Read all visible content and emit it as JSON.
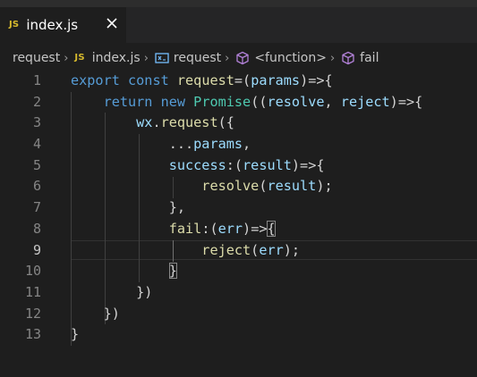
{
  "tab": {
    "icon_text": "JS",
    "label": "index.js"
  },
  "breadcrumb": [
    {
      "label": "request"
    },
    {
      "icon_text": "JS",
      "label": "index.js"
    },
    {
      "label": "request"
    },
    {
      "label": "<function>"
    },
    {
      "label": "fail"
    }
  ],
  "editor": {
    "line_numbers": [
      "1",
      "2",
      "3",
      "4",
      "5",
      "6",
      "7",
      "8",
      "9",
      "10",
      "11",
      "12",
      "13"
    ],
    "active_line": 9,
    "lines": [
      [
        {
          "t": "export ",
          "c": "k"
        },
        {
          "t": "const ",
          "c": "k"
        },
        {
          "t": "request",
          "c": "f"
        },
        {
          "t": "=(",
          "c": "p"
        },
        {
          "t": "params",
          "c": "v"
        },
        {
          "t": ")=>{",
          "c": "p"
        }
      ],
      [
        {
          "t": "    return ",
          "c": "k"
        },
        {
          "t": "new ",
          "c": "k"
        },
        {
          "t": "Promise",
          "c": "c"
        },
        {
          "t": "((",
          "c": "p"
        },
        {
          "t": "resolve",
          "c": "v"
        },
        {
          "t": ", ",
          "c": "p"
        },
        {
          "t": "reject",
          "c": "v"
        },
        {
          "t": ")=>{",
          "c": "p"
        }
      ],
      [
        {
          "t": "        wx",
          "c": "v"
        },
        {
          "t": ".",
          "c": "p"
        },
        {
          "t": "request",
          "c": "f"
        },
        {
          "t": "({",
          "c": "p"
        }
      ],
      [
        {
          "t": "            ...",
          "c": "p"
        },
        {
          "t": "params",
          "c": "v"
        },
        {
          "t": ",",
          "c": "p"
        }
      ],
      [
        {
          "t": "            success",
          "c": "v"
        },
        {
          "t": ":(",
          "c": "p"
        },
        {
          "t": "result",
          "c": "v"
        },
        {
          "t": ")=>{",
          "c": "p"
        }
      ],
      [
        {
          "t": "                resolve",
          "c": "f"
        },
        {
          "t": "(",
          "c": "p"
        },
        {
          "t": "result",
          "c": "v"
        },
        {
          "t": ");",
          "c": "p"
        }
      ],
      [
        {
          "t": "            },",
          "c": "p"
        }
      ],
      [
        {
          "t": "            fail",
          "c": "f"
        },
        {
          "t": ":(",
          "c": "p"
        },
        {
          "t": "err",
          "c": "v"
        },
        {
          "t": ")=>",
          "c": "p"
        },
        {
          "t": "{",
          "c": "p",
          "m": true
        }
      ],
      [
        {
          "t": "                reject",
          "c": "f"
        },
        {
          "t": "(",
          "c": "p"
        },
        {
          "t": "err",
          "c": "v"
        },
        {
          "t": ");",
          "c": "p"
        }
      ],
      [
        {
          "t": "            ",
          "c": "p"
        },
        {
          "t": "}",
          "c": "p",
          "m": true
        }
      ],
      [
        {
          "t": "        })",
          "c": "p"
        }
      ],
      [
        {
          "t": "    })",
          "c": "p"
        }
      ],
      [
        {
          "t": "}",
          "c": "p"
        }
      ]
    ]
  }
}
